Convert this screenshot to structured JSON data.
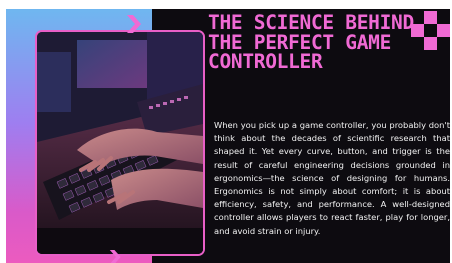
{
  "title": "THE SCIENCE BEHIND THE PERFECT GAME CONTROLLER",
  "body": "When you pick up a game controller, you probably don't think about the decades of scientific research that shaped it. Yet every curve, button, and trigger is the result of careful engineering decisions grounded in ergonomics—the science of designing for humans. Ergonomics is not simply about comfort; it is about efficiency, safety, and performance. A well-designed controller allows players to react faster, play for longer, and avoid strain or injury.",
  "colors": {
    "background": "#0d0b10",
    "accent_pink": "#f06ad4",
    "gradient_top": "#6fb7f0",
    "gradient_bottom": "#ec5bbf",
    "body_text": "#f3f3f3"
  },
  "icons": [
    "chevron-arrow-icon",
    "pixel-plus-icon"
  ],
  "image": "hands typing on backlit gaming keyboard"
}
